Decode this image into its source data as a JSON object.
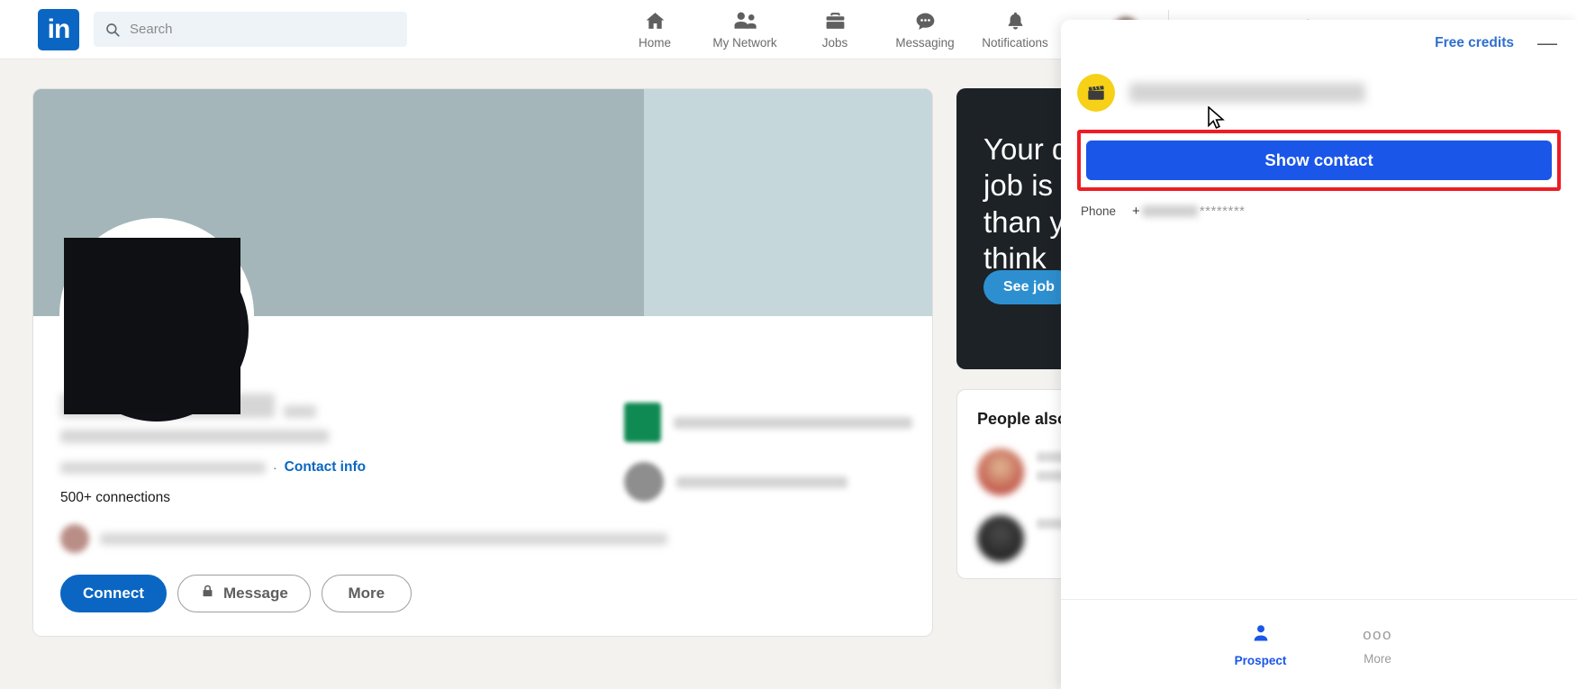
{
  "nav": {
    "logo_text": "in",
    "search_placeholder": "Search",
    "search_value": "",
    "items": [
      {
        "label": "Home",
        "icon": "home-icon"
      },
      {
        "label": "My Network",
        "icon": "people-icon"
      },
      {
        "label": "Jobs",
        "icon": "briefcase-icon"
      },
      {
        "label": "Messaging",
        "icon": "message-bubble-icon"
      },
      {
        "label": "Notifications",
        "icon": "bell-icon"
      }
    ],
    "me_label": "",
    "work_label": ""
  },
  "profile": {
    "name": "",
    "pronouns": "",
    "headline": "",
    "location": "",
    "contact_info_label": "Contact info",
    "connections": "500+ connections",
    "separator": "·",
    "buttons": {
      "connect": "Connect",
      "message": "Message",
      "more": "More"
    },
    "company": "",
    "education": ""
  },
  "sidebar": {
    "promo": {
      "line1": "Your d",
      "line2": "job is",
      "line3": "than y",
      "line4": "think",
      "cta": "See job"
    },
    "people_also": {
      "title": "People also"
    }
  },
  "overlay": {
    "free_credits": "Free credits",
    "minimize": "—",
    "person_name": "",
    "badge_icon": "clapperboard-icon",
    "cta_label": "Show contact",
    "fields": [
      {
        "label": "Phone",
        "prefix": "+",
        "mask": "********"
      }
    ],
    "footer_tabs": [
      {
        "label": "Prospect",
        "icon": "person-icon",
        "active": true
      },
      {
        "label": "More",
        "icon": "dots-icon",
        "active": false
      }
    ]
  },
  "colors": {
    "linkedin_blue": "#0a66c2",
    "overlay_cta_blue": "#1a56e8",
    "highlight_red": "#ee1c24",
    "badge_yellow": "#f7d117"
  }
}
